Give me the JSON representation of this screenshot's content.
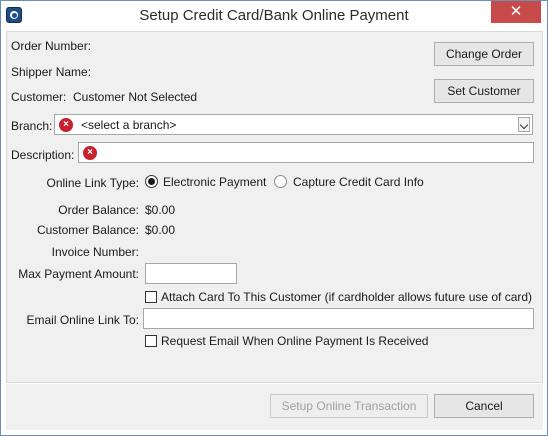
{
  "window": {
    "title": "Setup Credit Card/Bank Online Payment",
    "close_glyph": "✕"
  },
  "header": {
    "order_number_label": "Order Number:",
    "shipper_name_label": "Shipper Name:",
    "customer_label": "Customer:",
    "customer_value": "Customer Not Selected",
    "change_order_label": "Change Order",
    "set_customer_label": "Set Customer"
  },
  "form": {
    "branch_label": "Branch:",
    "branch_selected": "<select a branch>",
    "description_label": "Description:",
    "description_value": "",
    "error_glyph": "×",
    "online_link_type_label": "Online Link Type:",
    "link_type_options": [
      "Electronic Payment",
      "Capture Credit Card Info"
    ],
    "link_type_selected": "Electronic Payment",
    "order_balance_label": "Order Balance:",
    "order_balance_value": "$0.00",
    "customer_balance_label": "Customer Balance:",
    "customer_balance_value": "$0.00",
    "invoice_number_label": "Invoice Number:",
    "max_payment_label": "Max Payment Amount:",
    "max_payment_value": "",
    "attach_card_label": "Attach Card To This Customer (if cardholder allows future use of card)",
    "attach_card_checked": false,
    "email_link_label": "Email Online Link To:",
    "email_link_value": "",
    "request_email_label": "Request Email When Online Payment Is Received",
    "request_email_checked": false
  },
  "footer": {
    "setup_label": "Setup Online Transaction",
    "setup_enabled": false,
    "cancel_label": "Cancel"
  },
  "colors": {
    "close_button": "#c74b4b",
    "error_icon": "#c8202c",
    "border": "#6e8fb5"
  }
}
